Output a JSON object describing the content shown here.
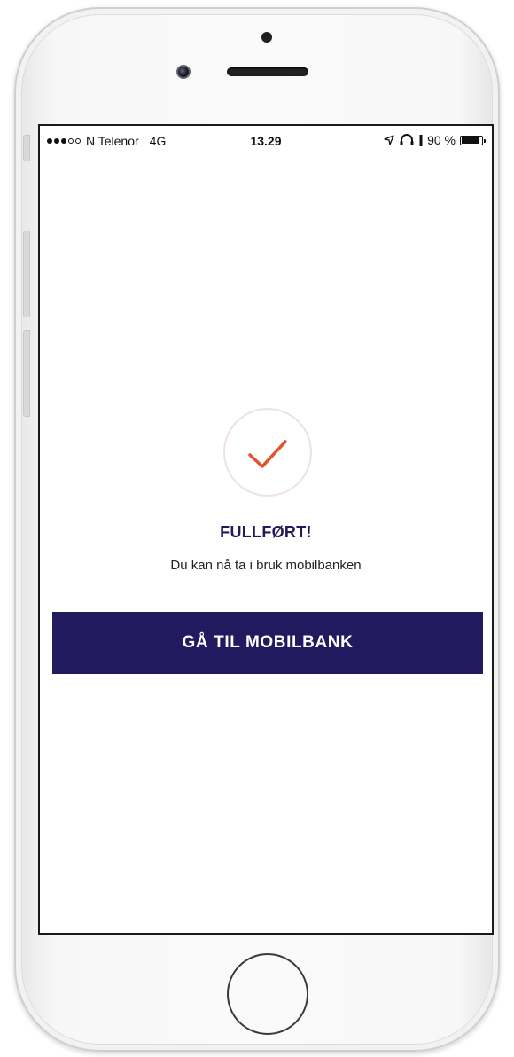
{
  "statusbar": {
    "carrier": "N Telenor",
    "network": "4G",
    "time": "13.29",
    "battery": "90 %",
    "signal_bars_filled": 3,
    "signal_bars_total": 5
  },
  "confirmation": {
    "icon": "checkmark-icon",
    "title": "FULLFØRT!",
    "subtitle": "Du kan nå ta i bruk mobilbanken"
  },
  "actions": {
    "primary_label": "GÅ TIL MOBILBANK"
  },
  "colors": {
    "brand_dark": "#221a5e",
    "accent_check": "#e2542c",
    "circle_border": "#eee3dc"
  }
}
